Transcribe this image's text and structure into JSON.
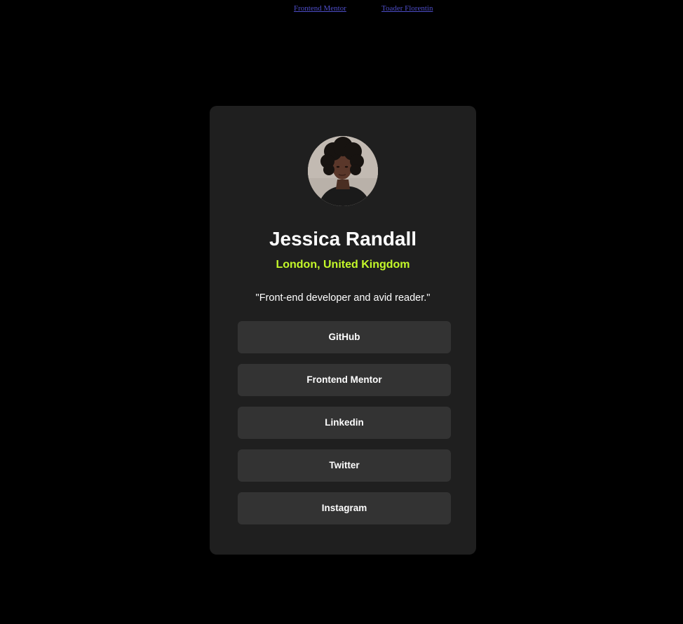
{
  "attribution": {
    "frontend_mentor": "Frontend Mentor",
    "author": "Toader Florentin"
  },
  "profile": {
    "avatar_icon": "profile-photo",
    "name": "Jessica Randall",
    "location": "London, United Kingdom",
    "bio": "\"Front-end developer and avid reader.\""
  },
  "links": [
    {
      "label": "GitHub"
    },
    {
      "label": "Frontend Mentor"
    },
    {
      "label": "Linkedin"
    },
    {
      "label": "Twitter"
    },
    {
      "label": "Instagram"
    }
  ],
  "colors": {
    "page_background": "#000000",
    "card_background": "#1f1f1f",
    "button_background": "#333333",
    "accent": "#c4f82a",
    "attribution_link": "#4d4dc7"
  }
}
